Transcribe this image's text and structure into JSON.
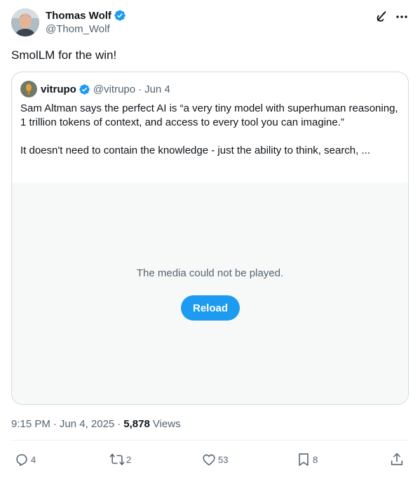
{
  "author": {
    "display_name": "Thomas Wolf",
    "handle": "@Thom_Wolf"
  },
  "tweet": {
    "text": "SmolLM for the win!"
  },
  "quoted": {
    "display_name": "vitrupo",
    "handle": "@vitrupo",
    "separator": "·",
    "date": "Jun 4",
    "paragraph_1": "Sam Altman says the perfect AI is “a very tiny model with superhuman reasoning, 1 trillion tokens of context, and access to every tool you can imagine.”",
    "paragraph_2": "It doesn't need to contain the knowledge - just the ability to think, search, ...",
    "media": {
      "message": "The media could not be played.",
      "reload_label": "Reload"
    }
  },
  "meta": {
    "time": "9:15 PM",
    "separator": "·",
    "date": "Jun 4, 2025",
    "views_count": "5,878",
    "views_label": "Views"
  },
  "actions": {
    "replies": "4",
    "reposts": "2",
    "likes": "53",
    "bookmarks": "8"
  },
  "colors": {
    "accent": "#1d9bf0",
    "text_primary": "#0f1419",
    "text_secondary": "#536471",
    "border": "#cfd9de"
  },
  "icons": [
    "verified-badge-icon",
    "grok-icon",
    "more-icon",
    "reply-icon",
    "repost-icon",
    "like-icon",
    "bookmark-icon",
    "share-icon"
  ]
}
